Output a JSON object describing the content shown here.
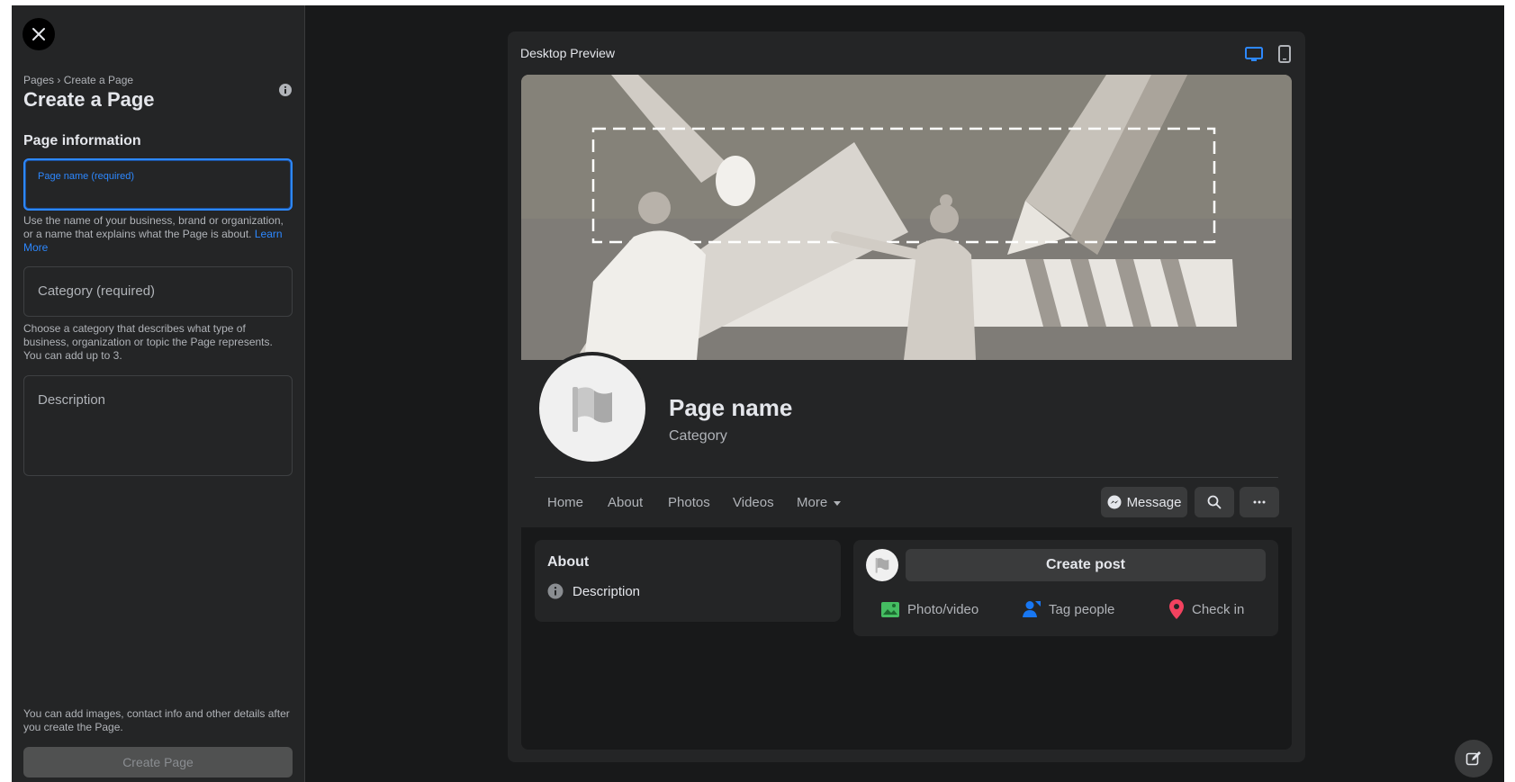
{
  "sidebar": {
    "breadcrumb": "Pages › Create a Page",
    "title": "Create a Page",
    "section_title": "Page information",
    "page_name_label": "Page name (required)",
    "page_name_help": "Use the name of your business, brand or organization, or a name that explains what the Page is about.",
    "learn_more": "Learn More",
    "category_label": "Category (required)",
    "category_help": "Choose a category that describes what type of business, organization or topic the Page represents. You can add up to 3.",
    "description_label": "Description",
    "footer_note": "You can add images, contact info and other details after you create the Page.",
    "create_button": "Create Page"
  },
  "preview": {
    "title": "Desktop Preview",
    "active_device": "desktop",
    "page_name": "Page name",
    "category": "Category",
    "tabs": [
      "Home",
      "About",
      "Photos",
      "Videos",
      "More"
    ],
    "message_button": "Message",
    "about": {
      "title": "About",
      "description": "Description"
    },
    "create_post": "Create post",
    "actions": {
      "photo": "Photo/video",
      "tag": "Tag people",
      "checkin": "Check in"
    }
  },
  "colors": {
    "accent": "#2d88ff",
    "background": "#18191a",
    "panel": "#242526",
    "photo_icon": "#45bd62",
    "tag_icon": "#1877f2",
    "checkin_icon": "#f3425f"
  }
}
